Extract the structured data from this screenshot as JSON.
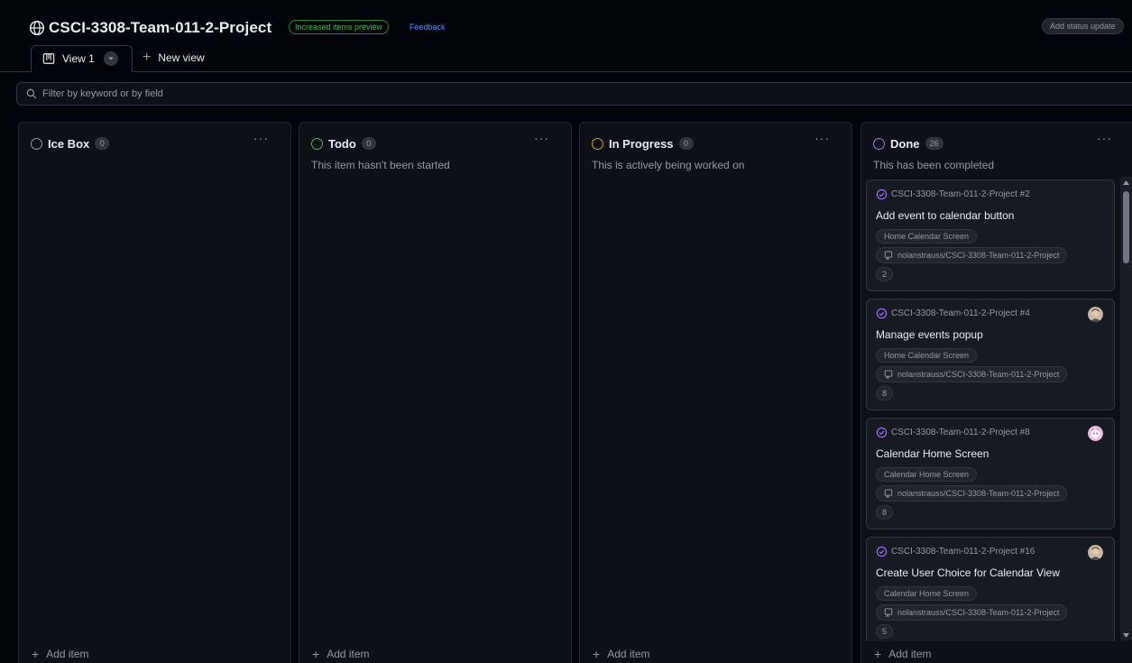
{
  "header": {
    "title": "CSCI-3308-Team-011-2-Project",
    "preview_badge": "Increased items preview",
    "feedback": "Feedback",
    "status_update": "Add status update"
  },
  "tabs": {
    "view1": "View 1",
    "new_view": "New view"
  },
  "filter": {
    "placeholder": "Filter by keyword or by field"
  },
  "columns": [
    {
      "name": "Ice Box",
      "count": "0",
      "description": "",
      "color": "#9198a1",
      "add_label": "Add item"
    },
    {
      "name": "Todo",
      "count": "0",
      "description": "This item hasn't been started",
      "color": "#3fb950",
      "add_label": "Add item"
    },
    {
      "name": "In Progress",
      "count": "0",
      "description": "This is actively being worked on",
      "color": "#d29922",
      "add_label": "Add item"
    },
    {
      "name": "Done",
      "count": "26",
      "description": "This has been completed",
      "color": "#a371f7",
      "add_label": "Add item"
    }
  ],
  "cards": [
    {
      "repo": "CSCI-3308-Team-011-2-Project #2",
      "title": "Add event to calendar button",
      "label": "Home Calendar Screen",
      "repository": "nolanstrauss/CSCI-3308-Team-011-2-Project",
      "estimate": "2"
    },
    {
      "repo": "CSCI-3308-Team-011-2-Project #4",
      "title": "Manage events popup",
      "label": "Home Calendar Screen",
      "repository": "nolanstrauss/CSCI-3308-Team-011-2-Project",
      "estimate": "8"
    },
    {
      "repo": "CSCI-3308-Team-011-2-Project #8",
      "title": "Calendar Home Screen",
      "label": "Calendar Home Screen",
      "repository": "nolanstrauss/CSCI-3308-Team-011-2-Project",
      "estimate": "8"
    },
    {
      "repo": "CSCI-3308-Team-011-2-Project #16",
      "title": "Create User Choice for Calendar View",
      "label": "Calendar Home Screen",
      "repository": "nolanstrauss/CSCI-3308-Team-011-2-Project",
      "estimate": "5"
    }
  ],
  "icons": [
    "globe-icon",
    "board-icon",
    "chevron-down-icon",
    "plus-icon",
    "search-icon",
    "more-icon",
    "issue-closed-icon",
    "repo-icon",
    "avatar"
  ],
  "colors": {
    "background": "#010409",
    "column": "#0d1117",
    "card": "#161b22",
    "done": "#a371f7",
    "link": "#4493f8"
  }
}
